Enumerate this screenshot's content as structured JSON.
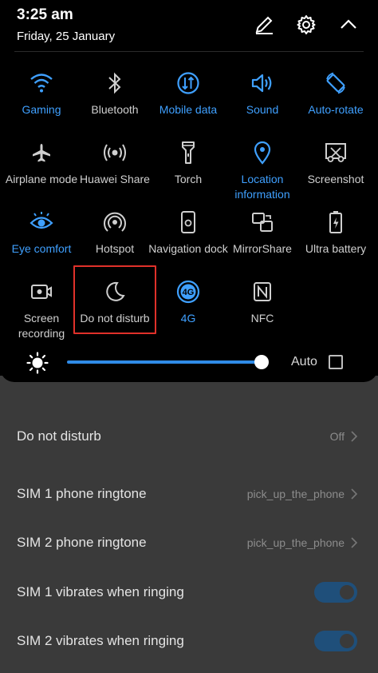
{
  "header": {
    "time": "3:25 am",
    "date": "Friday, 25 January"
  },
  "tiles": [
    {
      "label": "Gaming",
      "icon": "wifi-icon",
      "active": true
    },
    {
      "label": "Bluetooth",
      "icon": "bluetooth-icon",
      "active": false
    },
    {
      "label": "Mobile data",
      "icon": "mobile-data-icon",
      "active": true
    },
    {
      "label": "Sound",
      "icon": "speaker-icon",
      "active": true
    },
    {
      "label": "Auto-rotate",
      "icon": "rotate-icon",
      "active": true
    },
    {
      "label": "Airplane mode",
      "icon": "airplane-icon",
      "active": false
    },
    {
      "label": "Huawei Share",
      "icon": "share-icon",
      "active": false
    },
    {
      "label": "Torch",
      "icon": "torch-icon",
      "active": false
    },
    {
      "label": "Location information",
      "icon": "location-icon",
      "active": true
    },
    {
      "label": "Screenshot",
      "icon": "screenshot-icon",
      "active": false
    },
    {
      "label": "Eye comfort",
      "icon": "eye-icon",
      "active": true
    },
    {
      "label": "Hotspot",
      "icon": "hotspot-icon",
      "active": false
    },
    {
      "label": "Navigation dock",
      "icon": "navigation-dock-icon",
      "active": false
    },
    {
      "label": "MirrorShare",
      "icon": "mirror-share-icon",
      "active": false
    },
    {
      "label": "Ultra battery",
      "icon": "battery-icon",
      "active": false
    },
    {
      "label": "Screen recording",
      "icon": "screen-recording-icon",
      "active": false
    },
    {
      "label": "Do not disturb",
      "icon": "moon-icon",
      "active": false
    },
    {
      "label": "4G",
      "icon": "4g-icon",
      "active": true
    },
    {
      "label": "NFC",
      "icon": "nfc-icon",
      "active": false
    }
  ],
  "brightness": {
    "auto_label": "Auto",
    "level": 0.97,
    "auto_checked": false
  },
  "settings": [
    {
      "label": "Do not disturb",
      "value": "Off",
      "kind": "chevron"
    },
    {
      "label": "SIM 1 phone ringtone",
      "value": "pick_up_the_phone",
      "kind": "chevron"
    },
    {
      "label": "SIM 2 phone ringtone",
      "value": "pick_up_the_phone",
      "kind": "chevron"
    },
    {
      "label": "SIM 1 vibrates when ringing",
      "value": "",
      "kind": "toggle",
      "on": true
    },
    {
      "label": "SIM 2 vibrates when ringing",
      "value": "",
      "kind": "toggle",
      "on": true
    }
  ],
  "colors": {
    "accent": "#3fa0ff",
    "inactive": "#cfcfcf",
    "highlight": "#e0312a"
  }
}
